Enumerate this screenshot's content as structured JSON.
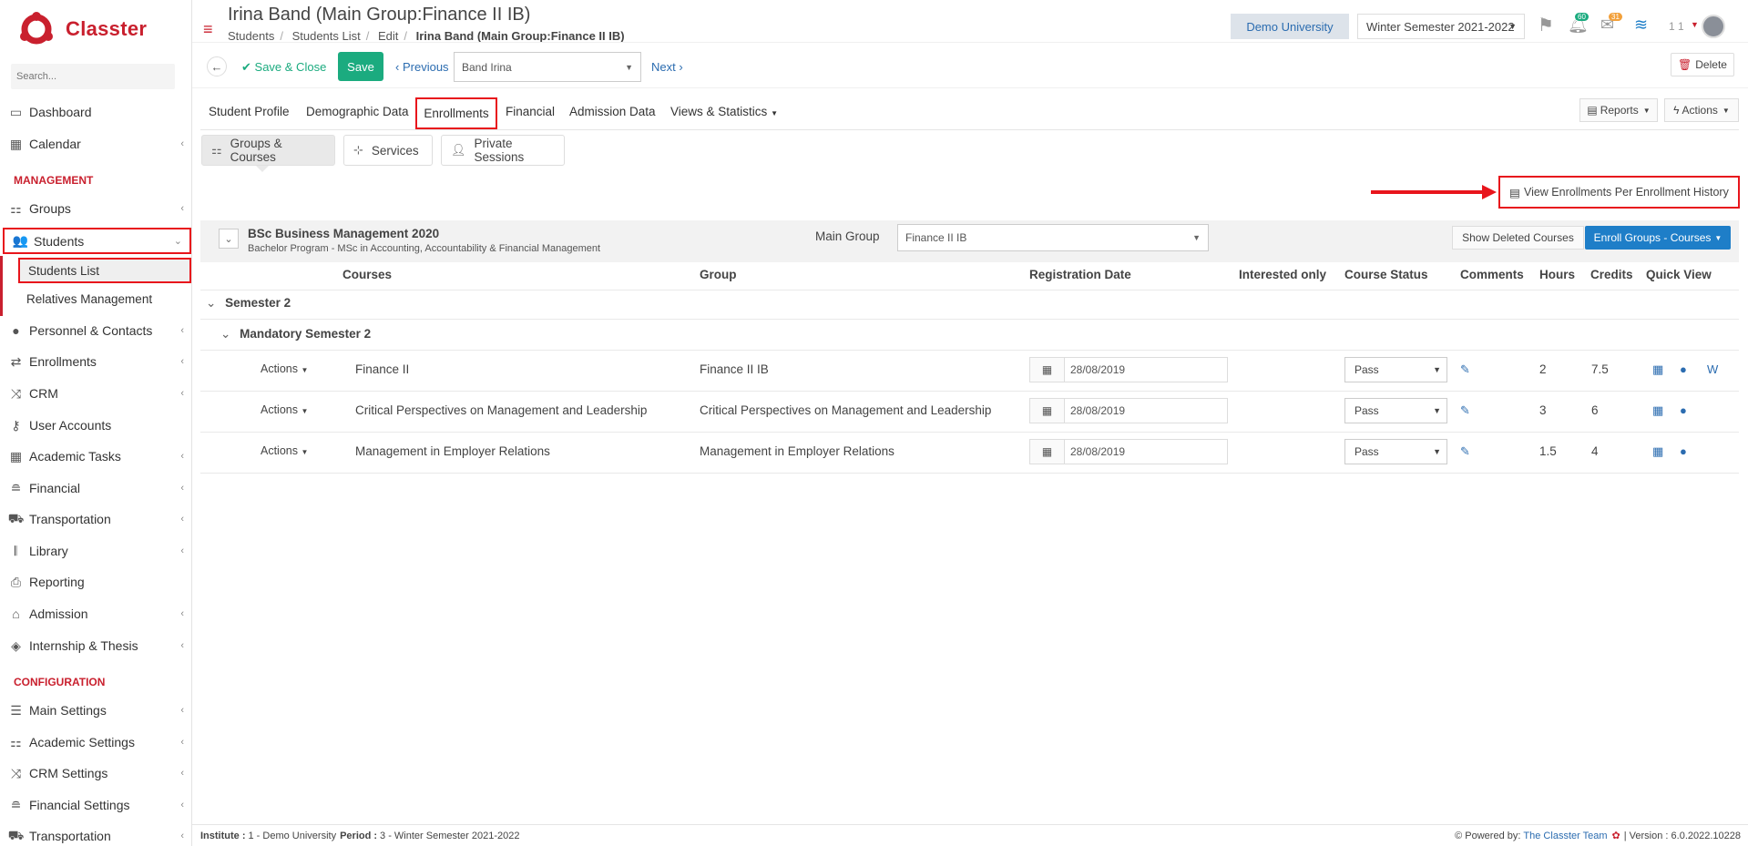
{
  "app": {
    "name": "Classter",
    "brand_color": "#c9202e",
    "accent_color": "#1e7ec8"
  },
  "sidebar": {
    "search_placeholder": "Search...",
    "items_top": [
      {
        "label": "Dashboard",
        "icon": "monitor-icon"
      },
      {
        "label": "Calendar",
        "icon": "calendar-icon"
      }
    ],
    "section_management": "MANAGEMENT",
    "management_items": [
      {
        "label": "Groups",
        "icon": "groups-icon"
      },
      {
        "label": "Students",
        "icon": "students-icon"
      }
    ],
    "students_sub": [
      {
        "label": "Students List"
      },
      {
        "label": "Relatives Management"
      }
    ],
    "management_items2": [
      {
        "label": "Personnel & Contacts",
        "icon": "person-icon"
      },
      {
        "label": "Enrollments",
        "icon": "exchange-icon"
      },
      {
        "label": "CRM",
        "icon": "shuffle-icon"
      },
      {
        "label": "User Accounts",
        "icon": "key-icon"
      },
      {
        "label": "Academic Tasks",
        "icon": "grid-icon"
      },
      {
        "label": "Financial",
        "icon": "coins-icon"
      },
      {
        "label": "Transportation",
        "icon": "bus-icon"
      },
      {
        "label": "Library",
        "icon": "books-icon"
      },
      {
        "label": "Reporting",
        "icon": "printer-icon"
      },
      {
        "label": "Admission",
        "icon": "institution-icon"
      },
      {
        "label": "Internship & Thesis",
        "icon": "cube-icon"
      }
    ],
    "section_configuration": "CONFIGURATION",
    "config_items": [
      {
        "label": "Main Settings",
        "icon": "sliders-icon"
      },
      {
        "label": "Academic Settings",
        "icon": "groups-icon"
      },
      {
        "label": "CRM Settings",
        "icon": "shuffle-icon"
      },
      {
        "label": "Financial Settings",
        "icon": "coins-icon"
      },
      {
        "label": "Transportation",
        "icon": "bus-icon"
      }
    ]
  },
  "header": {
    "title": "Irina Band (Main Group:Finance II IB)",
    "breadcrumb": [
      "Students",
      "Students List",
      "Edit"
    ],
    "breadcrumb_current": "Irina Band (Main Group:Finance II IB)",
    "institution": "Demo University",
    "period": "Winter Semester 2021-2022",
    "notif_count": "60",
    "mail_count": "31",
    "user_label": "1 1"
  },
  "toolbar": {
    "save_close": "Save & Close",
    "save": "Save",
    "previous": "Previous",
    "record_select": "Band Irina",
    "next": "Next",
    "delete": "Delete"
  },
  "tabs": {
    "items": [
      "Student Profile",
      "Demographic Data",
      "Enrollments",
      "Financial",
      "Admission Data",
      "Views & Statistics"
    ],
    "active": "Enrollments",
    "reports": "Reports",
    "actions": "Actions"
  },
  "subtabs": [
    "Groups & Courses",
    "Services",
    "Private Sessions"
  ],
  "history_button": "View Enrollments Per Enrollment History",
  "program": {
    "name": "BSc Business Management 2020",
    "description": "Bachelor Program - MSc in Accounting, Accountability & Financial Management",
    "main_group_label": "Main Group",
    "main_group_value": "Finance II IB",
    "show_deleted": "Show Deleted Courses",
    "enroll_button": "Enroll Groups - Courses"
  },
  "table": {
    "headers": [
      "Courses",
      "Group",
      "Registration Date",
      "Interested only",
      "Course Status",
      "Comments",
      "Hours",
      "Credits",
      "Quick View"
    ],
    "semester": "Semester 2",
    "subgroup": "Mandatory Semester 2",
    "rows": [
      {
        "actions": "Actions",
        "course": "Finance II",
        "group": "Finance II IB",
        "date": "28/08/2019",
        "status": "Pass",
        "hours": "2",
        "credits": "7.5",
        "w": "W"
      },
      {
        "actions": "Actions",
        "course": "Critical Perspectives on Management and Leadership",
        "group": "Critical Perspectives on Management and Leadership",
        "date": "28/08/2019",
        "status": "Pass",
        "hours": "3",
        "credits": "6",
        "w": ""
      },
      {
        "actions": "Actions",
        "course": "Management in Employer Relations",
        "group": "Management in Employer Relations",
        "date": "28/08/2019",
        "status": "Pass",
        "hours": "1.5",
        "credits": "4",
        "w": ""
      }
    ]
  },
  "footer": {
    "institute_label": "Institute :",
    "institute_value": "1 - Demo University",
    "period_label": "Period :",
    "period_value": "3 - Winter Semester 2021-2022",
    "powered_by": "Powered by:",
    "team": "The Classter Team",
    "version": "| Version : 6.0.2022.10228"
  }
}
